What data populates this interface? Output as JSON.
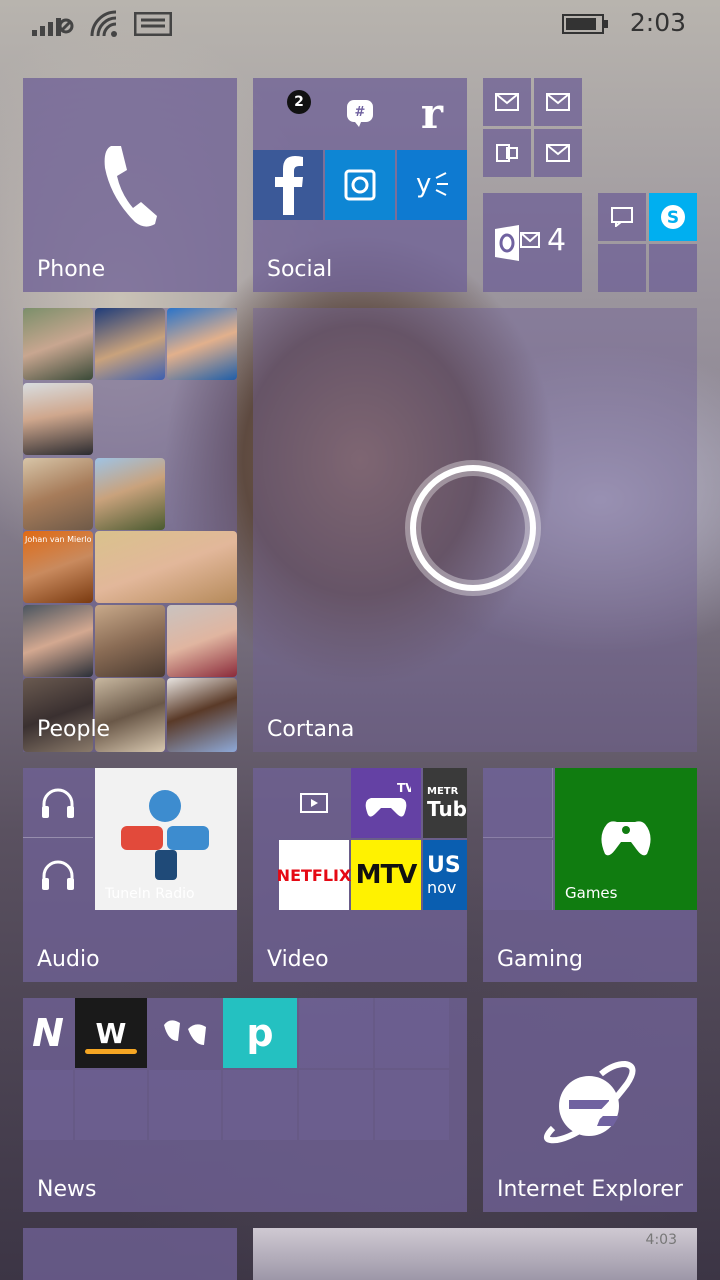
{
  "status": {
    "time": "2:03"
  },
  "tiles": {
    "phone": {
      "label": "Phone"
    },
    "social": {
      "label": "Social",
      "badge": "2",
      "r_letter": "r"
    },
    "outlook": {
      "count": "4"
    },
    "people": {
      "label": "People",
      "contact_name": "Johan van Mierlo"
    },
    "cortana": {
      "label": "Cortana"
    },
    "audio": {
      "label": "Audio",
      "tunein_label": "TuneIn Radio"
    },
    "video": {
      "label": "Video",
      "netflix": "NETFLIX",
      "mtv": "MTV",
      "tv": "TV",
      "metro_line1": "METR",
      "metro_line2": "Tub",
      "us_line1": "US",
      "us_line2": "nov"
    },
    "gaming": {
      "label": "Gaming",
      "games_label": "Games"
    },
    "news": {
      "label": "News",
      "n_letter": "N",
      "w_letter": "W",
      "p_letter": "p"
    },
    "internet_explorer": {
      "label": "Internet Explorer"
    },
    "bottom_mini_time": "4:03"
  },
  "colors": {
    "tile": "#7062a0",
    "facebook": "#3b5998",
    "twitter_blue": "#0e86d4",
    "skype": "#00aff0",
    "games_green": "#107c10",
    "netflix_red": "#e50914",
    "mtv_yellow": "#fff200",
    "pluto_teal": "#24c1c1"
  }
}
